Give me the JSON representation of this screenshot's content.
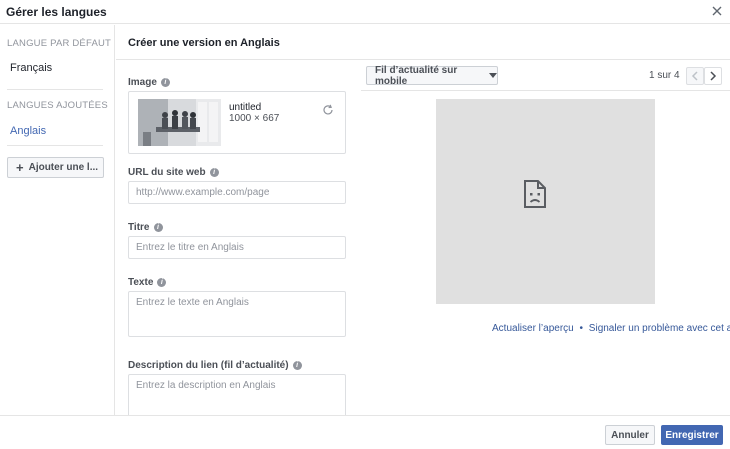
{
  "dialog": {
    "title": "Gérer les langues"
  },
  "sidebar": {
    "default_heading": "LANGUE PAR DÉFAUT",
    "default_language": "Français",
    "added_heading": "LANGUES AJOUTÉES",
    "added_languages": [
      "Anglais"
    ],
    "add_button_label": "Ajouter une l..."
  },
  "form": {
    "title": "Créer une version en Anglais",
    "image": {
      "label": "Image",
      "file_name": "untitled",
      "file_size": "1000 × 667"
    },
    "url": {
      "label": "URL du site web",
      "placeholder": "http://www.example.com/page"
    },
    "title_field": {
      "label": "Titre",
      "placeholder": "Entrez le titre en Anglais"
    },
    "text_field": {
      "label": "Texte",
      "placeholder": "Entrez le texte en Anglais"
    },
    "link_desc": {
      "label": "Description du lien (fil d’actualité)",
      "placeholder": "Entrez la description en Anglais"
    }
  },
  "preview": {
    "placement": "Fil d’actualité sur mobile",
    "pager": "1 sur 4",
    "refresh_link": "Actualiser l’aperçu",
    "separator": "•",
    "report_link": "Signaler un problème avec cet aperçu"
  },
  "footer": {
    "cancel_label": "Annuler",
    "save_label": "Enregistrer"
  },
  "colors": {
    "accent": "#4267b2",
    "link": "#365899",
    "border": "#e5e5e5",
    "muted": "#90949c"
  },
  "icons": [
    "close-icon",
    "plus-icon",
    "info-icon",
    "refresh-icon",
    "caret-down-icon",
    "chevron-left-icon",
    "chevron-right-icon",
    "broken-image-icon"
  ]
}
